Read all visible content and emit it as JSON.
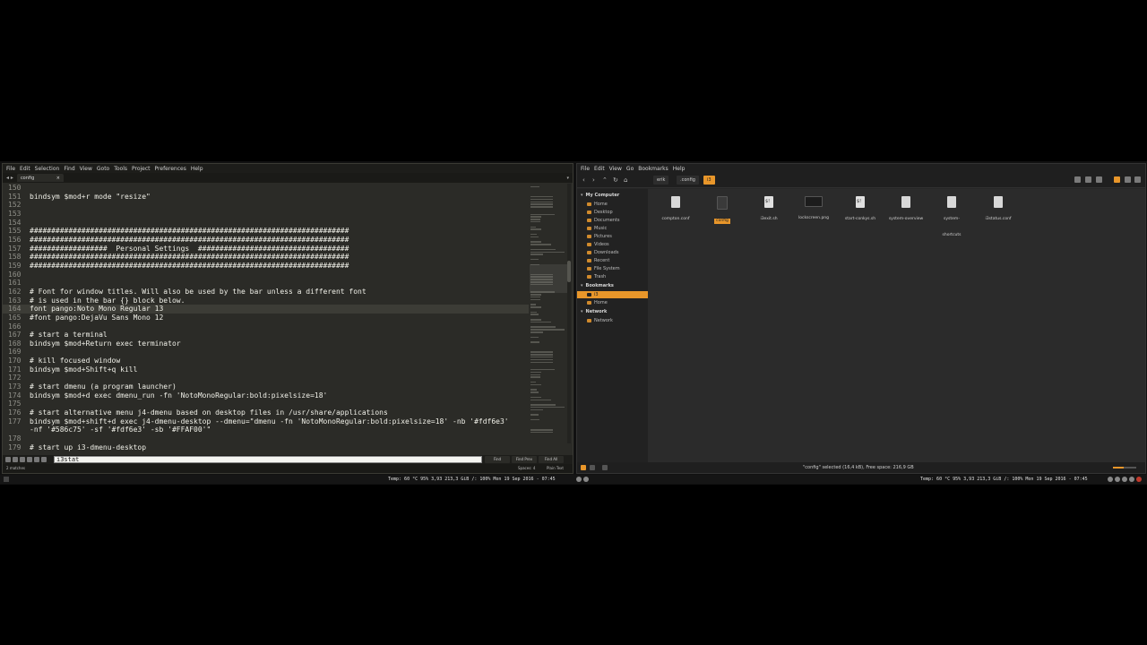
{
  "editor": {
    "menu": [
      "File",
      "Edit",
      "Selection",
      "Find",
      "View",
      "Goto",
      "Tools",
      "Project",
      "Preferences",
      "Help"
    ],
    "tab_arrows": "◂ ▸",
    "tab": {
      "label": "config",
      "close": "×"
    },
    "tab_dropdown": "▾",
    "lines": [
      {
        "num": "150",
        "text": ""
      },
      {
        "num": "151",
        "text": "bindsym $mod+r mode \"resize\""
      },
      {
        "num": "152",
        "text": ""
      },
      {
        "num": "153",
        "text": ""
      },
      {
        "num": "154",
        "text": ""
      },
      {
        "num": "155",
        "text": "##########################################################################"
      },
      {
        "num": "156",
        "text": "##########################################################################"
      },
      {
        "num": "157",
        "text": "##################  Personal Settings  ###################################"
      },
      {
        "num": "158",
        "text": "##########################################################################"
      },
      {
        "num": "159",
        "text": "##########################################################################"
      },
      {
        "num": "160",
        "text": ""
      },
      {
        "num": "161",
        "text": ""
      },
      {
        "num": "162",
        "text": "# Font for window titles. Will also be used by the bar unless a different font"
      },
      {
        "num": "163",
        "text": "# is used in the bar {} block below."
      },
      {
        "num": "164",
        "text": "font pango:Noto Mono Regular 13"
      },
      {
        "num": "165",
        "text": "#font pango:DejaVu Sans Mono 12"
      },
      {
        "num": "166",
        "text": ""
      },
      {
        "num": "167",
        "text": "# start a terminal"
      },
      {
        "num": "168",
        "text": "bindsym $mod+Return exec terminator"
      },
      {
        "num": "169",
        "text": ""
      },
      {
        "num": "170",
        "text": "# kill focused window"
      },
      {
        "num": "171",
        "text": "bindsym $mod+Shift+q kill"
      },
      {
        "num": "172",
        "text": ""
      },
      {
        "num": "173",
        "text": "# start dmenu (a program launcher)"
      },
      {
        "num": "174",
        "text": "bindsym $mod+d exec dmenu_run -fn 'NotoMonoRegular:bold:pixelsize=18'"
      },
      {
        "num": "175",
        "text": ""
      },
      {
        "num": "176",
        "text": "# start alternative menu j4-dmenu based on desktop files in /usr/share/applications"
      },
      {
        "num": "177",
        "text": "bindsym $mod+shift+d exec j4-dmenu-desktop --dmenu=\"dmenu -fn 'NotoMonoRegular:bold:pixelsize=18' -nb '#fdf6e3'"
      },
      {
        "num": "",
        "text": "-nf '#586c75' -sf '#fdf6e3' -sb '#FFAF00'\""
      },
      {
        "num": "178",
        "text": ""
      },
      {
        "num": "179",
        "text": "# start up i3-dmenu-desktop"
      }
    ],
    "find": {
      "value": "i3stat",
      "find_btn": "Find",
      "find_prev_btn": "Find Prev",
      "find_all_btn": "Find All"
    },
    "status": {
      "left": "2 matches",
      "spaces": "Spaces: 4",
      "syntax": "Plain Text"
    }
  },
  "filemanager": {
    "menu": [
      "File",
      "Edit",
      "View",
      "Go",
      "Bookmarks",
      "Help"
    ],
    "nav_icons": [
      "‹",
      "›",
      "⌃",
      "↻",
      "⌂"
    ],
    "breadcrumbs": [
      "erik",
      ".config",
      "i3"
    ],
    "sidebar": {
      "my_computer": "My Computer",
      "computer_items": [
        "Home",
        "Desktop",
        "Documents",
        "Music",
        "Pictures",
        "Videos",
        "Downloads",
        "Recent",
        "File System",
        "Trash"
      ],
      "bookmarks": "Bookmarks",
      "bookmark_items": [
        "i3",
        "Home"
      ],
      "network": "Network",
      "network_items": [
        "Network"
      ]
    },
    "files": [
      {
        "name": "compton.conf",
        "kind": "doc"
      },
      {
        "name": "config",
        "kind": "dark"
      },
      {
        "name": "i3exit.sh",
        "kind": "sh"
      },
      {
        "name": "lockscreen.png",
        "kind": "img"
      },
      {
        "name": "start-conkys.sh",
        "kind": "sh"
      },
      {
        "name": "system-overview",
        "kind": "doc"
      },
      {
        "name": "system-",
        "name2": "shortcuts",
        "kind": "doc"
      },
      {
        "name": "i3status.conf",
        "kind": "doc"
      }
    ],
    "status": "\"config\" selected (16,4 kB), Free space: 216,9 GB",
    "accent": "#e8962a"
  },
  "i3bar": {
    "left_status": "Temp: 60 °C 95% 3,93 213,3 GiB /: 100% Mon 19 Sep 2016 - 07:45",
    "right_status": "Temp: 60 °C 95% 3,93 213,3 GiB /: 100% Mon 19 Sep 2016 - 07:45"
  }
}
